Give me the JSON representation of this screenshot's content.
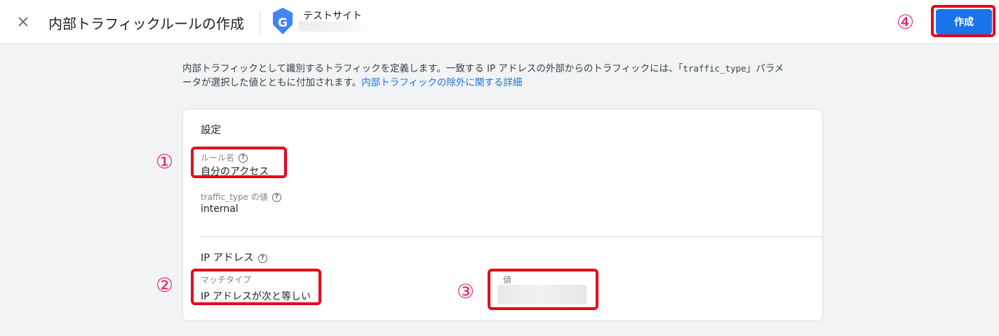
{
  "header": {
    "title": "内部トラフィックルールの作成",
    "site_name": "テストサイト",
    "logo_letter": "G",
    "create_label": "作成"
  },
  "intro": {
    "text_1": "内部トラフィックとして識別するトラフィックを定義します。一致する IP アドレスの外部からのトラフィックには、「",
    "param": "traffic_type",
    "text_2": "」パラメ",
    "text_3": "ータが選択した値とともに付加されます。",
    "link": "内部トラフィックの除外に関する詳細"
  },
  "settings": {
    "section_title": "設定",
    "rule_name_label": "ルール名",
    "rule_name_value": "自分のアクセス",
    "traffic_type_label": "traffic_type の値",
    "traffic_type_value": "internal"
  },
  "ip": {
    "section_title": "IP アドレス",
    "match_type_label": "マッチタイプ",
    "match_type_value": "IP アドレスが次と等しい",
    "value_label": "値"
  },
  "annotations": [
    "①",
    "②",
    "③",
    "④"
  ],
  "colors": {
    "accent": "#1a73e8",
    "annotation_border": "#e8001c",
    "annotation_number": "#e0246d"
  }
}
